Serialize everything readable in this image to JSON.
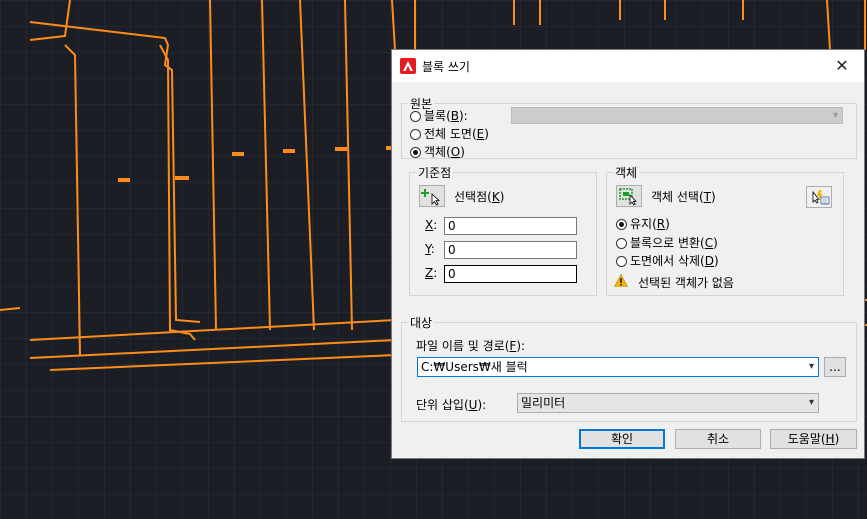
{
  "dialog": {
    "title": "블록 쓰기",
    "close_symbol": "✕",
    "source": {
      "label": "원본",
      "block_label": "블록(",
      "block_key": "B",
      "block_suffix": "):",
      "entire_drawing_label": "전체 도면(",
      "entire_drawing_key": "E",
      "objects_label": "객체(",
      "objects_key": "O",
      "close_paren": ")",
      "selected": "objects"
    },
    "base_point": {
      "label": "기준점",
      "pick_point_label": "선택점(",
      "pick_point_key": "K",
      "x_key": "X",
      "y_key": "Y",
      "z_key": "Z",
      "colon": ":",
      "x_value": "0",
      "y_value": "0",
      "z_value": "0"
    },
    "objects": {
      "label": "객체",
      "select_objects_label": "객체 선택(",
      "select_objects_key": "T",
      "retain_label": "유지(",
      "retain_key": "R",
      "convert_label": "블록으로 변환(",
      "convert_key": "C",
      "delete_label": "도면에서 삭제(",
      "delete_key": "D",
      "selected_option": "retain",
      "warning_text": "선택된 객체가 없음"
    },
    "destination": {
      "label": "대상",
      "file_path_label": "파일 이름 및 경로(",
      "file_path_key": "F",
      "file_path_suffix": "):",
      "file_path_value": "C:₩Users₩새 블럭",
      "browse_label": "...",
      "units_label": "단위 삽입(",
      "units_key": "U",
      "units_suffix": "):",
      "units_value": "밀리미터"
    },
    "buttons": {
      "ok": "확인",
      "cancel": "취소",
      "help_label": "도움말(",
      "help_key": "H",
      "help_suffix": ")"
    }
  },
  "colors": {
    "cad_background": "#1b1f25",
    "cad_lines": "#ff8c1a",
    "accent": "#0078d7"
  }
}
